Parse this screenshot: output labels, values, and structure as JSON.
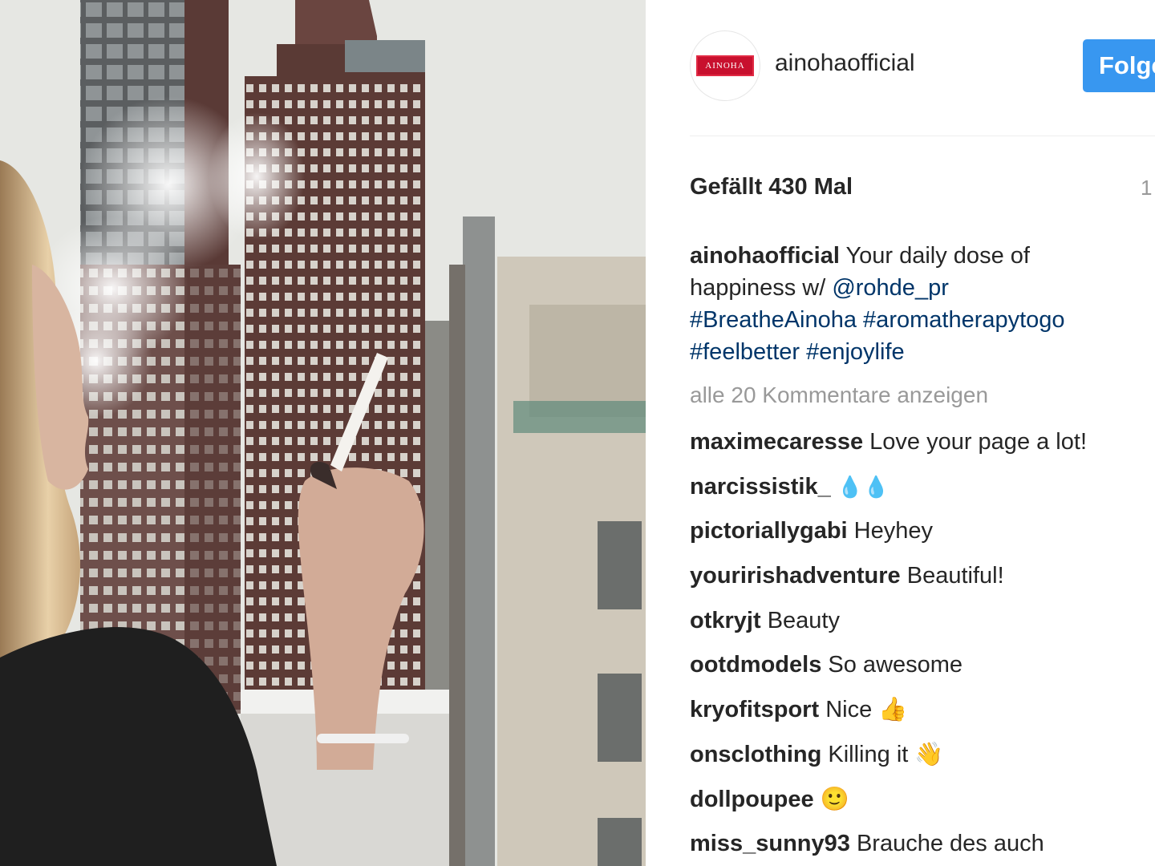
{
  "post": {
    "image_description_alt": "",
    "author": {
      "username": "ainohaofficial",
      "avatar_text": "AINOHA"
    },
    "follow_label": "Folgen",
    "likes_text": "Gefällt 430 Mal",
    "time_text": "1",
    "caption": {
      "username": "ainohaofficial",
      "text": " Your daily dose of happiness w/ ",
      "mention": "@rohde_pr",
      "hashtags": "#BreatheAinoha #aromatherapytogo #feelbetter #enjoylife"
    },
    "view_all_comments": "alle 20 Kommentare anzeigen",
    "comments": [
      {
        "username": "maximecaresse",
        "text": "Love your page a lot!"
      },
      {
        "username": "narcissistik_",
        "text": "💧💧"
      },
      {
        "username": "pictoriallygabi",
        "text": "Heyhey"
      },
      {
        "username": "youririshadventure",
        "text": "Beautiful!"
      },
      {
        "username": "otkryjt",
        "text": "Beauty"
      },
      {
        "username": "ootdmodels",
        "text": "So awesome"
      },
      {
        "username": "kryofitsport",
        "text": "Nice 👍"
      },
      {
        "username": "onsclothing",
        "text": "Killing it 👋"
      },
      {
        "username": "dollpoupee",
        "text": "🙂"
      },
      {
        "username": "miss_sunny93",
        "text": "Brauche des auch"
      }
    ]
  },
  "colors": {
    "accent": "#3897f0",
    "link": "#003569",
    "brand": "#c8102e"
  }
}
